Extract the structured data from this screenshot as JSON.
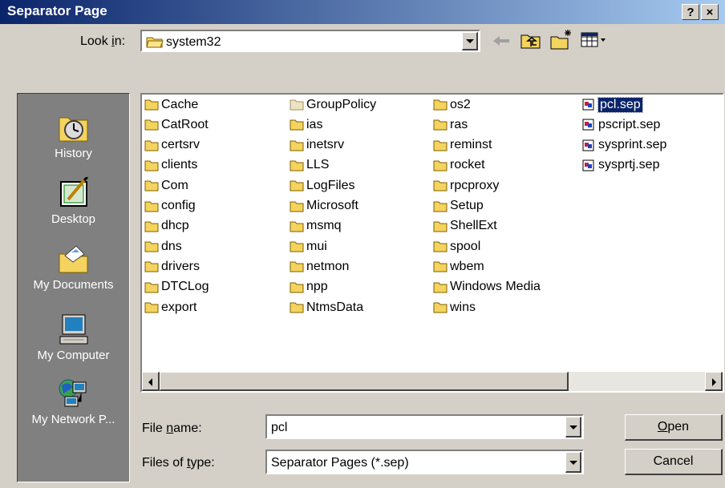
{
  "window": {
    "title": "Separator Page",
    "help_label": "?",
    "close_label": "×"
  },
  "lookin": {
    "label_pre": "Look ",
    "label_key": "i",
    "label_post": "n:",
    "value": "system32"
  },
  "places": [
    {
      "name": "History",
      "icon": "history-icon"
    },
    {
      "name": "Desktop",
      "icon": "desktop-icon"
    },
    {
      "name": "My Documents",
      "icon": "my-documents-icon"
    },
    {
      "name": "My Computer",
      "icon": "my-computer-icon"
    },
    {
      "name": "My Network P...",
      "icon": "my-network-places-icon"
    }
  ],
  "files": {
    "col1": [
      "Cache",
      "CatRoot",
      "certsrv",
      "clients",
      "Com",
      "config",
      "dhcp",
      "dns",
      "drivers",
      "DTCLog",
      "export"
    ],
    "col2": [
      "GroupPolicy",
      "ias",
      "inetsrv",
      "LLS",
      "LogFiles",
      "Microsoft",
      "msmq",
      "mui",
      "netmon",
      "npp",
      "NtmsData"
    ],
    "col3": [
      "os2",
      "ras",
      "reminst",
      "rocket",
      "rpcproxy",
      "Setup",
      "ShellExt",
      "spool",
      "wbem",
      "Windows Media",
      "wins"
    ],
    "col4": [
      "pcl.sep",
      "pscript.sep",
      "sysprint.sep",
      "sysprtj.sep"
    ],
    "selected": "pcl.sep"
  },
  "filename": {
    "label_pre": "File ",
    "label_key": "n",
    "label_post": "ame:",
    "value": "pcl"
  },
  "filetype": {
    "label_pre": "Files of ",
    "label_key": "t",
    "label_post": "ype:",
    "value": "Separator Pages (*.sep)"
  },
  "buttons": {
    "open_key": "O",
    "open_rest": "pen",
    "cancel": "Cancel"
  },
  "colors": {
    "title_start": "#0a246a",
    "title_end": "#a6caf0",
    "folder": "#f4d35e",
    "selection": "#0a246a"
  }
}
